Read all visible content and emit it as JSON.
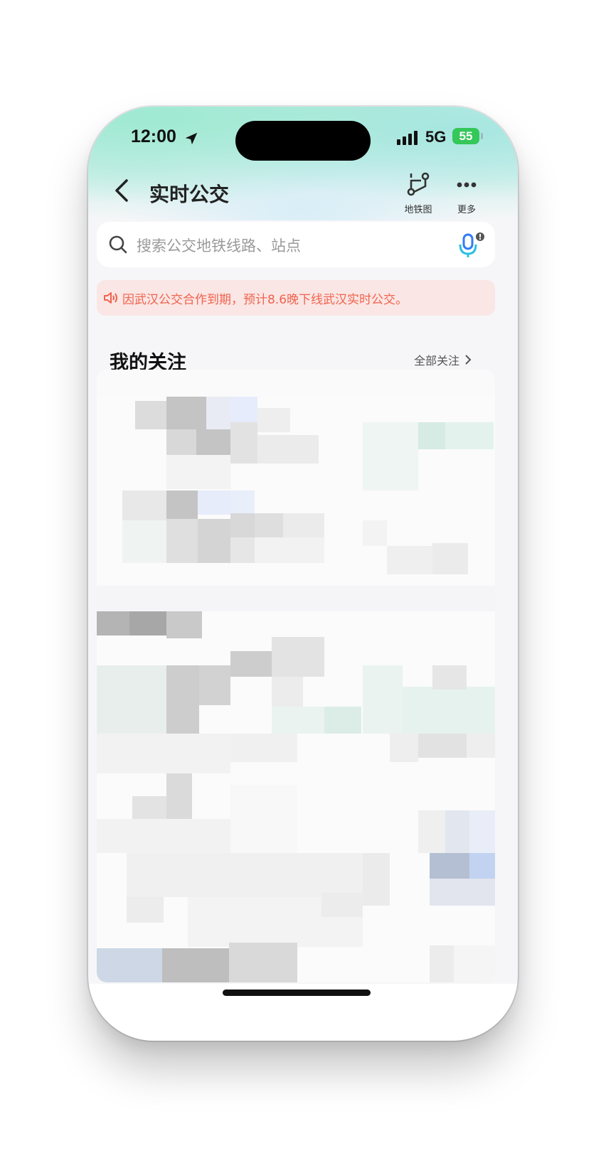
{
  "status_bar": {
    "time": "12:00",
    "network": "5G",
    "battery": "55"
  },
  "nav": {
    "title": "实时公交",
    "actions": [
      {
        "label": "地铁图",
        "icon": "subway-map-icon"
      },
      {
        "label": "更多",
        "icon": "more-dots-icon"
      }
    ]
  },
  "search": {
    "placeholder": "搜索公交地铁线路、站点"
  },
  "notice": {
    "text": "因武汉公交合作到期，预计8.6晚下线武汉实时公交。",
    "color": "#f0634e"
  },
  "section": {
    "title": "我的关注",
    "link": "全部关注"
  },
  "colors": {
    "accent": "#2f7cf6",
    "header_gradient": "#b8ece0",
    "battery": "#34c759"
  }
}
